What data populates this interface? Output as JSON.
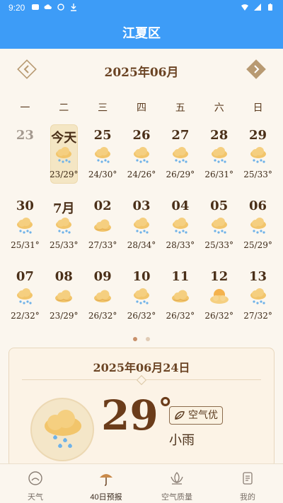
{
  "status": {
    "time": "9:20"
  },
  "header": {
    "title": "江夏区"
  },
  "calendar": {
    "month_title": "2025年06月",
    "weekdays": [
      "一",
      "二",
      "三",
      "四",
      "五",
      "六",
      "日"
    ],
    "days": [
      {
        "label": "23",
        "temp": "",
        "icon": "",
        "muted": true
      },
      {
        "label": "今天",
        "temp": "23/29°",
        "icon": "rain-cloud-icon",
        "today": true
      },
      {
        "label": "25",
        "temp": "24/30°",
        "icon": "rain-cloud-icon"
      },
      {
        "label": "26",
        "temp": "24/26°",
        "icon": "rain-cloud-icon"
      },
      {
        "label": "27",
        "temp": "26/29°",
        "icon": "rain-cloud-icon"
      },
      {
        "label": "28",
        "temp": "26/31°",
        "icon": "rain-cloud-icon"
      },
      {
        "label": "29",
        "temp": "25/33°",
        "icon": "rain-cloud-icon"
      },
      {
        "label": "30",
        "temp": "25/31°",
        "icon": "rain-cloud-icon"
      },
      {
        "label": "7月",
        "temp": "25/33°",
        "icon": "rain-cloud-icon"
      },
      {
        "label": "02",
        "temp": "27/33°",
        "icon": "cloud-icon"
      },
      {
        "label": "03",
        "temp": "28/34°",
        "icon": "rain-cloud-icon"
      },
      {
        "label": "04",
        "temp": "28/33°",
        "icon": "rain-cloud-icon"
      },
      {
        "label": "05",
        "temp": "25/33°",
        "icon": "rain-cloud-icon"
      },
      {
        "label": "06",
        "temp": "25/29°",
        "icon": "rain-cloud-icon"
      },
      {
        "label": "07",
        "temp": "22/32°",
        "icon": "rain-cloud-icon"
      },
      {
        "label": "08",
        "temp": "23/29°",
        "icon": "cloud-icon"
      },
      {
        "label": "09",
        "temp": "26/32°",
        "icon": "cloud-icon"
      },
      {
        "label": "10",
        "temp": "26/32°",
        "icon": "rain-cloud-icon"
      },
      {
        "label": "11",
        "temp": "26/32°",
        "icon": "cloud-icon"
      },
      {
        "label": "12",
        "temp": "26/32°",
        "icon": "sun-cloud-icon"
      },
      {
        "label": "13",
        "temp": "27/32°",
        "icon": "rain-cloud-icon"
      }
    ]
  },
  "detail": {
    "date": "2025年06月24日",
    "temperature": "29",
    "degree": "°",
    "aqi": "空气优",
    "condition": "小雨",
    "icon": "rain-cloud-icon"
  },
  "nav": {
    "tabs": [
      {
        "label": "天气",
        "icon": "weather-icon"
      },
      {
        "label": "40日预报",
        "icon": "umbrella-icon",
        "active": true
      },
      {
        "label": "空气质量",
        "icon": "lotus-icon"
      },
      {
        "label": "我的",
        "icon": "scroll-icon"
      }
    ]
  },
  "colors": {
    "header": "#3d9cf7",
    "background": "#fbf6ee",
    "cloud": "#f2c56b",
    "rain": "#6fb2e8",
    "accent_brown": "#6b4424"
  }
}
